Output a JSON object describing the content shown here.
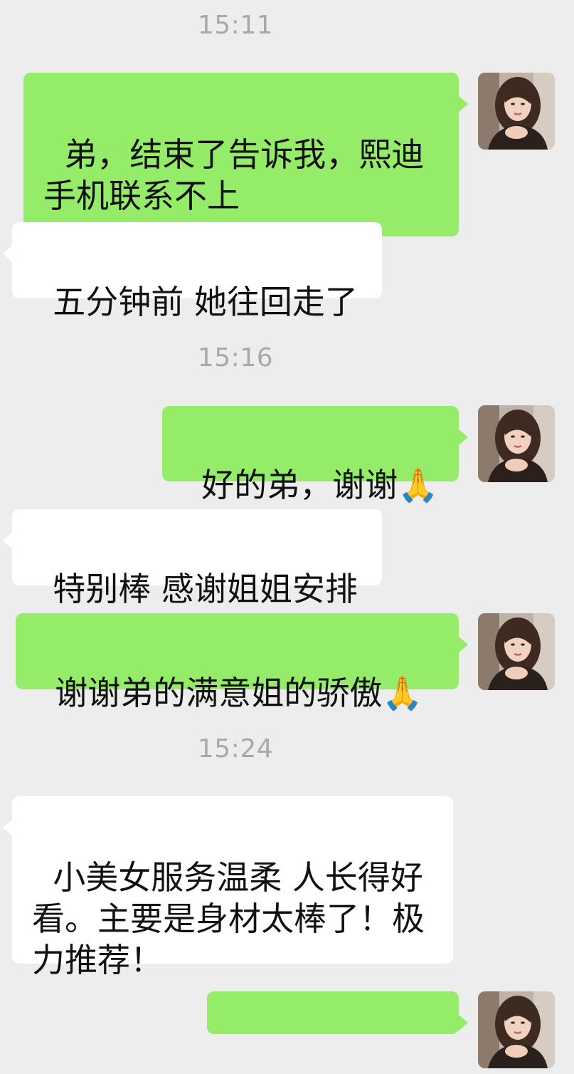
{
  "chat": {
    "timestamps": [
      "15:11",
      "15:16",
      "15:24"
    ],
    "messages": [
      {
        "side": "outgoing",
        "text": "弟，结束了告诉我，熙迪手机联系不上"
      },
      {
        "side": "incoming",
        "text": "五分钟前 她往回走了"
      },
      {
        "side": "outgoing",
        "text": "好的弟，谢谢🙏"
      },
      {
        "side": "incoming",
        "text": "特别棒 感谢姐姐安排"
      },
      {
        "side": "outgoing",
        "text": "谢谢弟的满意姐的骄傲🙏"
      },
      {
        "side": "incoming",
        "text": "小美女服务温柔 人长得好看。主要是身材太棒了！极力推荐！"
      },
      {
        "side": "outgoing",
        "text": ""
      }
    ]
  },
  "colors": {
    "background": "#ededed",
    "outgoing_bubble": "#95ec69",
    "incoming_bubble": "#ffffff",
    "timestamp": "#a9a9a9"
  },
  "icons": {
    "avatar": "user-avatar-photo"
  }
}
